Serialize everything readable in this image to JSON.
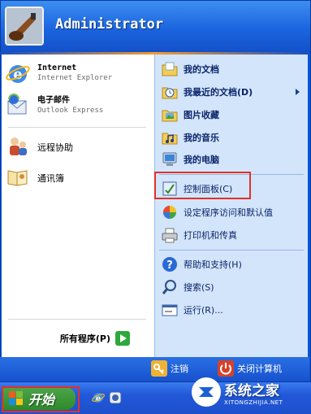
{
  "user": {
    "name": "Administrator"
  },
  "left_pinned": [
    {
      "title": "Internet",
      "subtitle": "Internet Explorer",
      "icon": "internet-explorer-icon"
    },
    {
      "title": "电子邮件",
      "subtitle": "Outlook Express",
      "icon": "outlook-express-icon"
    }
  ],
  "left_recent": [
    {
      "label": "远程协助",
      "icon": "remote-assistance-icon"
    },
    {
      "label": "通讯簿",
      "icon": "address-book-icon"
    }
  ],
  "all_programs": {
    "label": "所有程序(P)",
    "icon": "green-arrow-icon"
  },
  "right_items": [
    {
      "label": "我的文档",
      "bold": true,
      "icon": "my-documents-icon"
    },
    {
      "label": "我最近的文档(D)",
      "bold": true,
      "icon": "recent-documents-icon",
      "submenu": true
    },
    {
      "label": "图片收藏",
      "bold": true,
      "icon": "my-pictures-icon"
    },
    {
      "label": "我的音乐",
      "bold": true,
      "icon": "my-music-icon"
    },
    {
      "label": "我的电脑",
      "bold": true,
      "icon": "my-computer-icon"
    },
    {
      "label": "控制面板(C)",
      "bold": false,
      "icon": "control-panel-icon",
      "highlighted": true
    },
    {
      "label": "设定程序访问和默认值",
      "bold": false,
      "icon": "program-defaults-icon"
    },
    {
      "label": "打印机和传真",
      "bold": false,
      "icon": "printer-icon"
    },
    {
      "label": "帮助和支持(H)",
      "bold": false,
      "icon": "help-icon"
    },
    {
      "label": "搜索(S)",
      "bold": false,
      "icon": "search-icon"
    },
    {
      "label": "运行(R)...",
      "bold": false,
      "icon": "run-icon"
    }
  ],
  "footer": {
    "logoff_label": "注销",
    "shutdown_label": "关闭计算机"
  },
  "taskbar": {
    "start_label": "开始"
  },
  "watermark": {
    "title": "系统之家",
    "url": "XITONGZHIJIA.NET"
  },
  "colors": {
    "highlight": "#e0302a",
    "start_green": "#2e8a2a",
    "accent_blue": "#0a56d8"
  }
}
